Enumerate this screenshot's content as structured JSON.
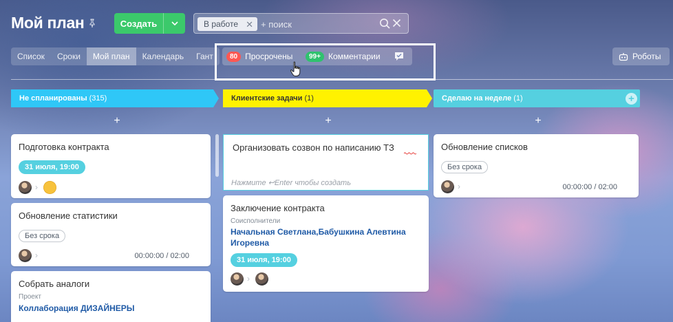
{
  "header": {
    "title": "Мой план",
    "create_label": "Создать",
    "filter_chip": "В работе",
    "search_placeholder": "+ поиск"
  },
  "view_tabs": [
    {
      "label": "Список"
    },
    {
      "label": "Сроки"
    },
    {
      "label": "Мой план",
      "active": true
    },
    {
      "label": "Календарь"
    },
    {
      "label": "Гант"
    }
  ],
  "counters": {
    "overdue_count": "80",
    "overdue_label": "Просрочены",
    "comments_count": "99+",
    "comments_label": "Комментарии"
  },
  "robots_label": "Роботы",
  "columns": [
    {
      "title": "Не спланированы",
      "count": "(315)",
      "color": "#2fc7f7",
      "text_color": "#ffffff"
    },
    {
      "title": "Клиентские задачи",
      "count": "(1)",
      "color": "#fff200",
      "text_color": "#333333"
    },
    {
      "title": "Сделаю на неделе",
      "count": "(1)",
      "color": "#55d0e0",
      "text_color": "#ffffff"
    }
  ],
  "cards": {
    "c1": {
      "title": "Подготовка контракта",
      "date": "31 июля, 19:00"
    },
    "c2": {
      "title": "Обновление статистики",
      "no_deadline": "Без срока",
      "time": "00:00:00 / 02:00"
    },
    "c3": {
      "title": "Собрать аналоги",
      "sub_label": "Проект",
      "link": "Коллаборация ДИЗАЙНЕРЫ"
    },
    "editor": {
      "text": "Организовать созвон по написанию ТЗ",
      "hint": "Нажмите ↩Enter чтобы создать"
    },
    "c4": {
      "title": "Заключение контракта",
      "sub_label": "Соисполнители",
      "link": "Начальная Светлана,Бабушкина Алевтина Игоревна",
      "date": "31 июля, 19:00"
    },
    "c5": {
      "title": "Обновление списков",
      "no_deadline": "Без срока",
      "time": "00:00:00 / 02:00"
    }
  },
  "add_symbol": "+",
  "colors": {
    "accent_green": "#3bc96b",
    "overdue_red": "#ff5752",
    "comments_green": "#2fc26e",
    "date_pill": "#55d0e0"
  }
}
